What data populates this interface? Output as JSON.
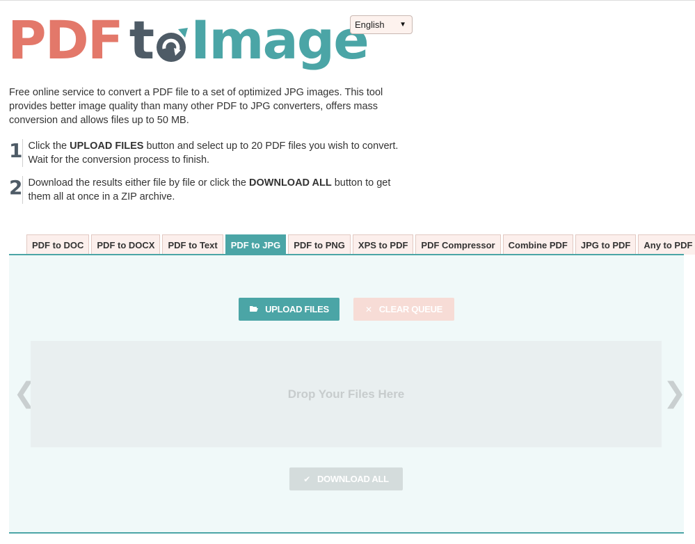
{
  "logo": {
    "part1": "PDF",
    "part2": "t",
    "part3": "Image"
  },
  "language": {
    "selected": "English"
  },
  "intro": "Free online service to convert a PDF file to a set of optimized JPG images. This tool provides better image quality than many other PDF to JPG converters, offers mass conversion and allows files up to 50 MB.",
  "steps": [
    {
      "num": "1",
      "pre": "Click the ",
      "bold": "UPLOAD FILES",
      "post": " button and select up to 20 PDF files you wish to convert. Wait for the conversion process to finish."
    },
    {
      "num": "2",
      "pre": "Download the results either file by file or click the ",
      "bold": "DOWNLOAD ALL",
      "post": " button to get them all at once in a ZIP archive."
    }
  ],
  "tabs": [
    {
      "label": "PDF to DOC",
      "active": false
    },
    {
      "label": "PDF to DOCX",
      "active": false
    },
    {
      "label": "PDF to Text",
      "active": false
    },
    {
      "label": "PDF to JPG",
      "active": true
    },
    {
      "label": "PDF to PNG",
      "active": false
    },
    {
      "label": "XPS to PDF",
      "active": false
    },
    {
      "label": "PDF Compressor",
      "active": false
    },
    {
      "label": "Combine PDF",
      "active": false
    },
    {
      "label": "JPG to PDF",
      "active": false
    },
    {
      "label": "Any to PDF",
      "active": false
    }
  ],
  "panel": {
    "upload_label": "UPLOAD FILES",
    "clear_label": "CLEAR QUEUE",
    "drop_label": "Drop Your Files Here",
    "download_label": "DOWNLOAD ALL",
    "prev_arrow": "❮",
    "next_arrow": "❯"
  },
  "colors": {
    "accent": "#4ba5a6",
    "brand_red": "#e3786a",
    "brand_dark": "#4e5b66"
  }
}
